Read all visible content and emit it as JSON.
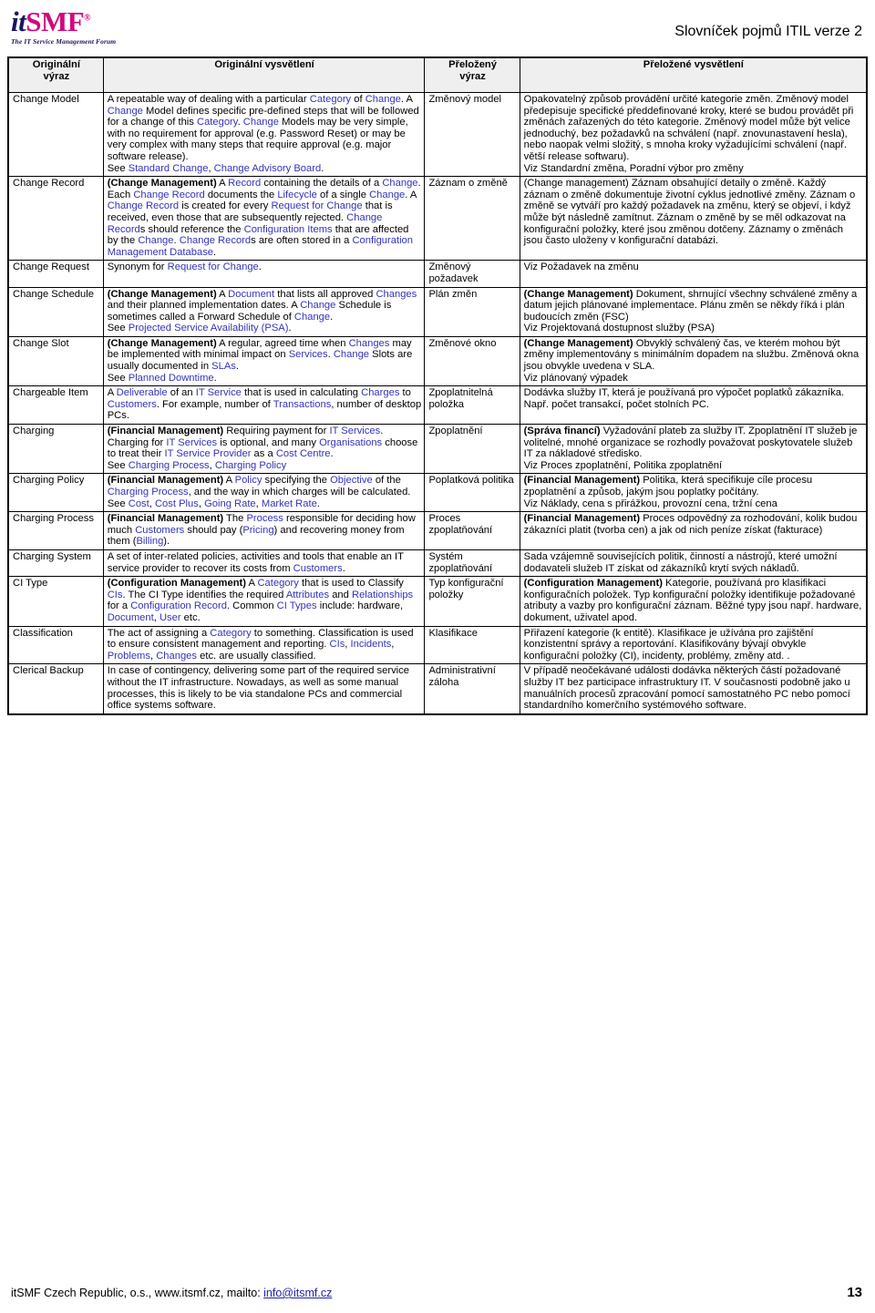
{
  "header": {
    "logo_it": "it",
    "logo_smf": "SMF",
    "logo_reg": "®",
    "logo_tagline": "The IT Service Management Forum",
    "title": "Slovníček pojmů ITIL verze 2"
  },
  "table": {
    "columns": [
      {
        "line1": "Originální",
        "line2": "výraz"
      },
      {
        "line1": "Originální vysvětlení",
        "line2": ""
      },
      {
        "line1": "Přeložený",
        "line2": "výraz"
      },
      {
        "line1": "Přeložené vysvětlení",
        "line2": ""
      }
    ],
    "rows": [
      {
        "term": "Change Model",
        "definition": "A repeatable way of dealing with a particular Category of Change. A Change Model defines specific pre-defined steps that will be followed for a change of this Category. Change Models may be very simple, with no requirement for approval (e.g. Password Reset) or may be very complex with many steps that require approval (e.g. major software release).\nSee Standard Change, Change Advisory Board.",
        "czech_term": "Změnový model",
        "czech_definition": "Opakovatelný způsob provádění určité kategorie změn. Změnový model předepisuje specifické předdefinované kroky, které se budou provádět při změnách zařazených do této kategorie. Změnový model může být velice jednoduchý, bez požadavků na schválení (např. znovunastavení hesla), nebo naopak velmi složitý, s mnoha kroky vyžadujícími schválení (např. větší release softwaru).\nViz Standardní změna,  Poradní výbor  pro změny"
      },
      {
        "term": "Change Record",
        "definition": "(Change Management) A Record containing the details of a Change. Each Change Record documents the Lifecycle of a single Change. A Change Record is created for every Request for Change that is received, even those that are subsequently rejected. Change Records should reference the Configuration Items that are affected by the Change.  Change Records are often stored in a Configuration Management Database.",
        "czech_term": "Záznam o změně",
        "czech_definition": "(Change management) Záznam obsahující detaily o změně. Každý záznam o změně dokumentuje životní cyklus jednotlivé změny. Záznam o změně se vytváří pro každý požadavek na změnu, který se objeví, i když může být následně zamítnut. Záznam o změně by se měl odkazovat na konfigurační položky, které jsou změnou dotčeny. Záznamy o změnách jsou často uloženy v konfigurační databázi."
      },
      {
        "term": "Change Request",
        "definition": "Synonym for Request for Change.",
        "czech_term": "Změnový požadavek",
        "czech_definition": "Viz Požadavek na změnu"
      },
      {
        "term": "Change Schedule",
        "definition": "(Change Management) A Document that lists all approved Changes and their planned implementation dates. A Change Schedule is sometimes called a Forward Schedule of Change.\nSee Projected Service Availability (PSA).",
        "czech_term": "Plán změn",
        "czech_definition": "(Change Management) Dokument, shrnující všechny schválené změny a datum jejich plánované implementace. Plánu změn se někdy říká  i plán budoucích změn (FSC)\nViz Projektovaná dostupnost služby (PSA)"
      },
      {
        "term": "Change Slot",
        "definition": "(Change Management) A regular, agreed time when Changes may be implemented with minimal impact on Services. Change Slots are usually documented in SLAs.\nSee Planned Downtime.",
        "czech_term": "Změnové okno",
        "czech_definition": "(Change Management) Obvyklý schválený čas, ve kterém mohou být změny implementovány s minimálním dopadem na službu. Změnová okna jsou obvykle uvedena v SLA.\nViz plánovaný výpadek"
      },
      {
        "term": "Chargeable Item",
        "definition": "A Deliverable of an IT Service that is used in calculating Charges to Customers. For example, number of Transactions, number of desktop PCs.",
        "czech_term": "Zpoplatnitelná položka",
        "czech_definition": "Dodávka služby IT, která je používaná pro výpočet poplatků zákazníka. Např. počet transakcí, počet stolních PC."
      },
      {
        "term": "Charging",
        "definition": "(Financial Management) Requiring payment for IT Services. Charging for IT Services is optional, and many Organisations choose to treat their IT Service Provider as a Cost Centre.\nSee Charging Process, Charging Policy",
        "czech_term": "Zpoplatnění",
        "czech_definition": "(Správa financí) Vyžadování plateb za služby IT. Zpoplatnění IT služeb je volitelné, mnohé organizace se rozhodly považovat  poskytovatele služeb IT za nákladové středisko.\nViz Proces zpoplatnění, Politika zpoplatnění"
      },
      {
        "term": "Charging Policy",
        "definition": "(Financial Management) A Policy specifying the Objective of the Charging Process, and the way in which charges will be calculated.\nSee Cost, Cost Plus, Going Rate, Market Rate.",
        "czech_term": "Poplatková politika",
        "czech_definition": "(Financial Management) Politika, která specifikuje cíle procesu zpoplatnění a způsob, jakým jsou poplatky počítány.\nViz Náklady, cena s přirážkou, provozní cena, tržní cena"
      },
      {
        "term": "Charging Process",
        "definition": "(Financial Management) The Process responsible for deciding how much Customers should pay (Pricing) and recovering money from them (Billing).",
        "czech_term": "Proces zpoplatňování",
        "czech_definition": "(Financial Management) Proces odpovědný za rozhodování, kolik budou zákazníci platit (tvorba cen) a  jak od nich peníze získat  (fakturace)"
      },
      {
        "term": "Charging System",
        "definition": "A set of inter-related policies, activities and tools that enable an IT service provider to recover its costs from Customers.",
        "czech_term": "Systém zpoplatňování",
        "czech_definition": "Sada vzájemně souvisejících politik, činností a nástrojů, které umožní dodavateli služeb IT získat od zákazníků krytí svých nákladů."
      },
      {
        "term": "CI Type",
        "definition": "(Configuration Management) A Category that is used to Classify CIs. The CI Type identifies the required Attributes and Relationships for a Configuration Record. Common CI Types include: hardware, Document, User etc.",
        "czech_term": "Typ konfigurační položky",
        "czech_definition": "(Configuration Management) Kategorie, používaná pro klasifikaci konfiguračních položek. Typ konfigurační položky identifikuje požadované atributy a vazby pro konfigurační záznam. Běžné typy jsou např. hardware, dokument, uživatel apod."
      },
      {
        "term": "Classification",
        "definition": "The act of assigning a Category to something. Classification is used to ensure consistent management and reporting. CIs, Incidents, Problems, Changes etc. are usually classified.",
        "czech_term": "Klasifikace",
        "czech_definition": "Přiřazení kategorie (k entitě). Klasifikace je užívána pro zajištění konzistentní správy a reportování. Klasifikovány bývají obvykle konfigurační položky (CI), incidenty, problémy, změny atd. ."
      },
      {
        "term": "Clerical Backup",
        "definition": "In case of contingency, delivering some part of the required service without the IT infrastructure. Nowadays, as well as some manual processes, this is likely to be via standalone PCs and commercial office systems software.",
        "czech_term": "Administrativní záloha",
        "czech_definition": "V případě neočekávané události dodávka některých částí požadované služby IT bez participace infrastruktury IT. V současnosti podobně jako u manuálních procesů zpracování pomocí samostatného PC nebo pomocí standardního komerčního systémového software."
      }
    ]
  },
  "footer": {
    "text": "itSMF Czech Republic, o.s., www.itsmf.cz, mailto: ",
    "email": "info@itsmf.cz",
    "page_number": "13"
  },
  "formatting": {
    "link_terms": [
      "Category",
      "Change",
      "Changes",
      "Record",
      "Lifecycle",
      "Request for Change",
      "Configuration Items",
      "Configuration Management Database",
      "Standard Change",
      "Change Advisory Board",
      "Document",
      "Projected Service Availability (PSA)",
      "Services",
      "SLAs",
      "Planned Downtime",
      "Deliverable",
      "IT Service",
      "IT Services",
      "Charges",
      "Customers",
      "Transactions",
      "Organisations",
      "IT Service Provider",
      "Cost Centre",
      "Charging Process",
      "Charging Policy",
      "Policy",
      "Objective",
      "Cost",
      "Cost Plus",
      "Going Rate",
      "Market Rate",
      "Process",
      "Pricing",
      "Billing",
      "CIs",
      "Attributes",
      "Relationships",
      "Configuration Record",
      "CI Types",
      "User",
      "Incidents",
      "Problems"
    ],
    "bold_prefixes": [
      "(Change Management)",
      "(Financial Management)",
      "(Configuration Management)",
      "(Správa financí)"
    ],
    "link_color": "#3333bb"
  }
}
